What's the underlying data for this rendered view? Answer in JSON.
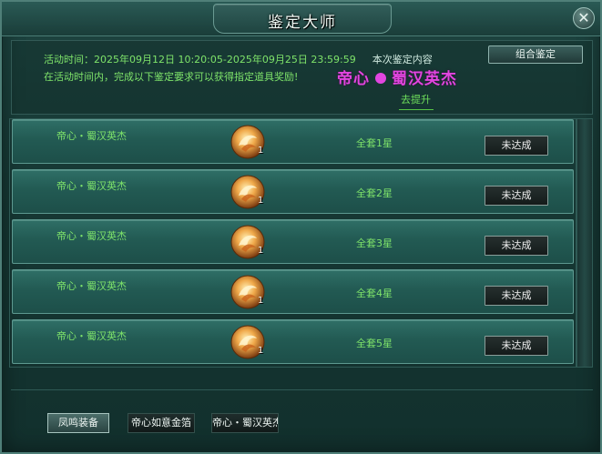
{
  "window": {
    "title": "鉴定大师",
    "close_label": "✕"
  },
  "info": {
    "time_label": "活动时间：2025年09月12日 10:20:05-2025年09月25日 23:59:59",
    "content_label": "本次鉴定内容",
    "desc": "在活动时间内，完成以下鉴定要求可以获得指定道具奖励!",
    "hero_name_left": "帝心",
    "hero_name_right": "蜀汉英杰",
    "goto_label": "去提升",
    "combo_button": "组合鉴定"
  },
  "rows": [
    {
      "name": "帝心・蜀汉英杰",
      "count": "1",
      "requirement": "全套1星",
      "status": "未达成"
    },
    {
      "name": "帝心・蜀汉英杰",
      "count": "1",
      "requirement": "全套2星",
      "status": "未达成"
    },
    {
      "name": "帝心・蜀汉英杰",
      "count": "1",
      "requirement": "全套3星",
      "status": "未达成"
    },
    {
      "name": "帝心・蜀汉英杰",
      "count": "1",
      "requirement": "全套4星",
      "status": "未达成"
    },
    {
      "name": "帝心・蜀汉英杰",
      "count": "1",
      "requirement": "全套5星",
      "status": "未达成"
    }
  ],
  "tabs": [
    {
      "label": "凤鸣装备"
    },
    {
      "label": "帝心如意金箔"
    },
    {
      "label": "帝心・蜀汉英杰"
    }
  ],
  "colors": {
    "accent_green": "#7ee36a",
    "hero_magenta": "#e246e0"
  },
  "icons": {
    "reward": "phoenix-medal-icon",
    "close": "close-icon"
  }
}
